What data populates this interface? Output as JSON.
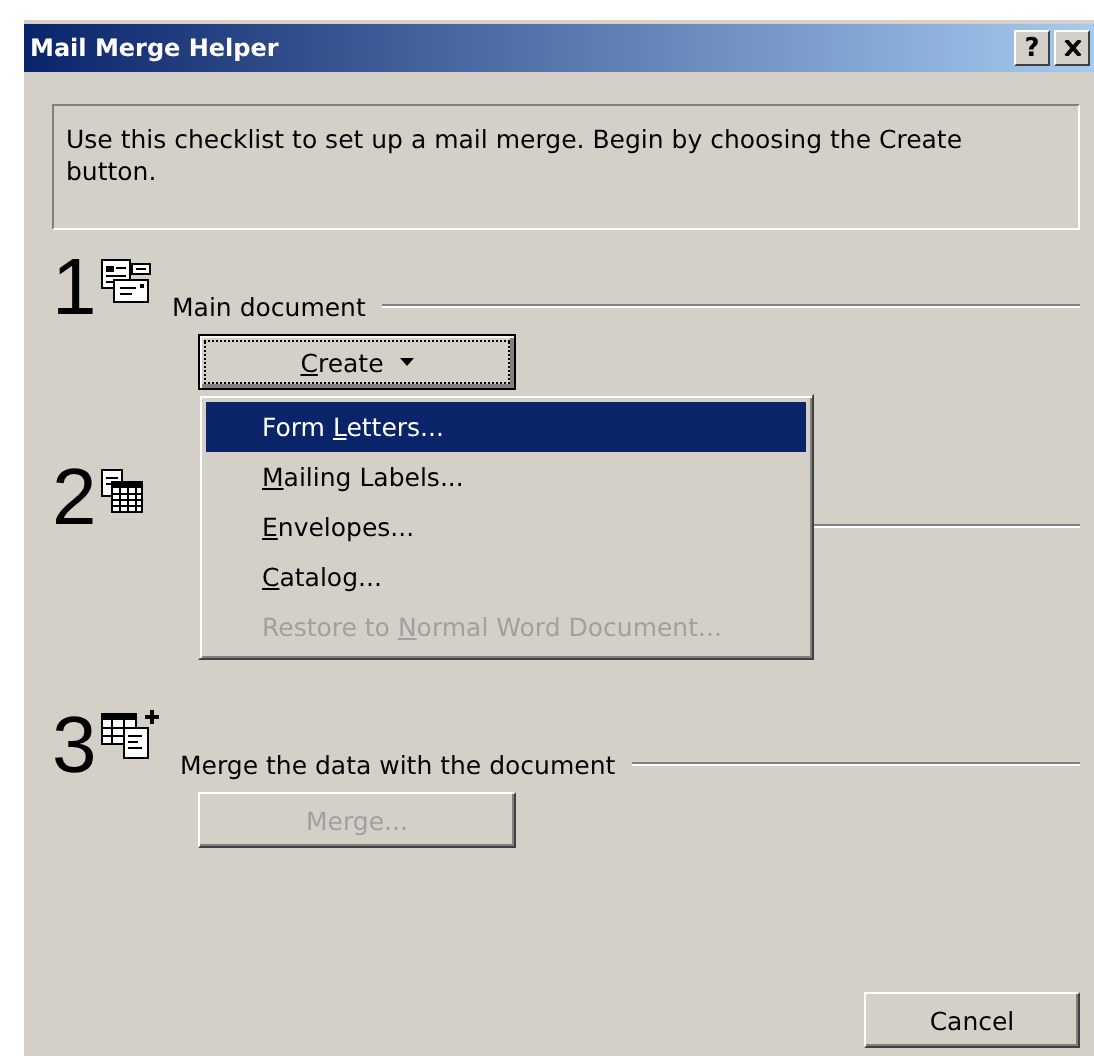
{
  "window": {
    "title": "Mail Merge Helper",
    "help_button": "?"
  },
  "instructions": "Use this checklist to set up a mail merge. Begin by choosing the Create button.",
  "steps": [
    {
      "number": "1",
      "label": "Main document",
      "button": {
        "label": {
          "key": "C",
          "after": "reate"
        },
        "dropdown": true,
        "disabled": false,
        "focused": true
      }
    },
    {
      "number": "2"
    },
    {
      "number": "3",
      "label": "Merge the data with the document",
      "button": {
        "label": {
          "before": "Merge..."
        },
        "dropdown": false,
        "disabled": true,
        "focused": false
      }
    }
  ],
  "menu": {
    "items": [
      {
        "label": {
          "before": "Form ",
          "key": "L",
          "after": "etters..."
        },
        "selected": true,
        "disabled": false
      },
      {
        "label": {
          "key": "M",
          "after": "ailing Labels..."
        },
        "selected": false,
        "disabled": false
      },
      {
        "label": {
          "key": "E",
          "after": "nvelopes..."
        },
        "selected": false,
        "disabled": false
      },
      {
        "label": {
          "key": "C",
          "after": "atalog..."
        },
        "selected": false,
        "disabled": false
      },
      {
        "label": {
          "before": "Restore to ",
          "key": "N",
          "after": "ormal Word Document..."
        },
        "selected": false,
        "disabled": true
      }
    ]
  },
  "cancel_button": "Cancel"
}
